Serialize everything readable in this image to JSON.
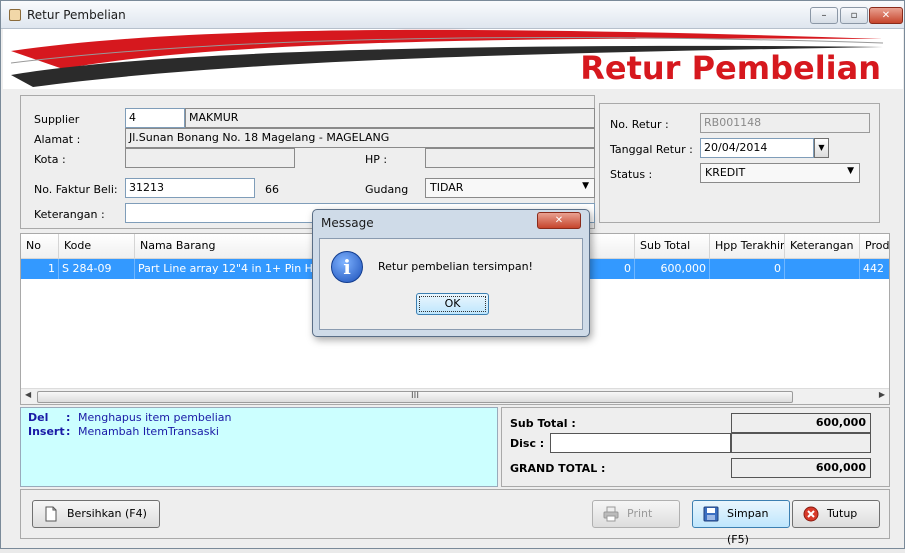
{
  "window": {
    "title": "Retur Pembelian"
  },
  "banner": {
    "title": "Retur Pembelian"
  },
  "form": {
    "supplier_label": "Supplier",
    "supplier_code": "4",
    "supplier_name": "MAKMUR",
    "alamat_label": "Alamat :",
    "alamat_value": "Jl.Sunan Bonang No. 18 Magelang - MAGELANG",
    "kota_label": "Kota :",
    "kota_value": "",
    "hp_label": "HP :",
    "hp_value": "",
    "faktur_label": "No. Faktur Beli:",
    "faktur_value": "31213",
    "faktur_extra": "66",
    "gudang_label": "Gudang",
    "gudang_value": "TIDAR",
    "keterangan_label": "Keterangan :",
    "keterangan_value": ""
  },
  "retur": {
    "no_label": "No. Retur :",
    "no_value": "RB001148",
    "tanggal_label": "Tanggal Retur :",
    "tanggal_value": "20/04/2014",
    "status_label": "Status :",
    "status_value": "KREDIT"
  },
  "table": {
    "columns": [
      "No",
      "Kode",
      "Nama Barang",
      "",
      "Sub Total",
      "Hpp Terakhir",
      "Keterangan",
      "Produ"
    ],
    "row": {
      "no": "1",
      "kode": "S 284-09",
      "nama": "Part Line array 12\"4 in 1+ Pin Hitam",
      "qty": "0",
      "subtotal": "600,000",
      "hpp": "0",
      "keterangan": "",
      "produ": "442"
    },
    "scroll_grip": "III"
  },
  "help": {
    "del_key": "Del",
    "del_text": "Menghapus item pembelian",
    "insert_key": "Insert",
    "insert_text": "Menambah ItemTransaski",
    "sep": ":"
  },
  "totals": {
    "subtotal_label": "Sub Total :",
    "subtotal_value": "600,000",
    "disc_label": "Disc :",
    "disc_value": "",
    "grand_label": "GRAND TOTAL :",
    "grand_value": "600,000"
  },
  "buttons": {
    "bersihkan": "Bersihkan (F4)",
    "print": "Print",
    "simpan": "Simpan (F5)",
    "tutup": "Tutup"
  },
  "dialog": {
    "title": "Message",
    "message": "Retur pembelian tersimpan!",
    "ok": "OK",
    "icon": "info-icon"
  },
  "colors": {
    "accent_red": "#d6181e",
    "selection": "#3399ff",
    "help_bg": "#ccffff"
  }
}
